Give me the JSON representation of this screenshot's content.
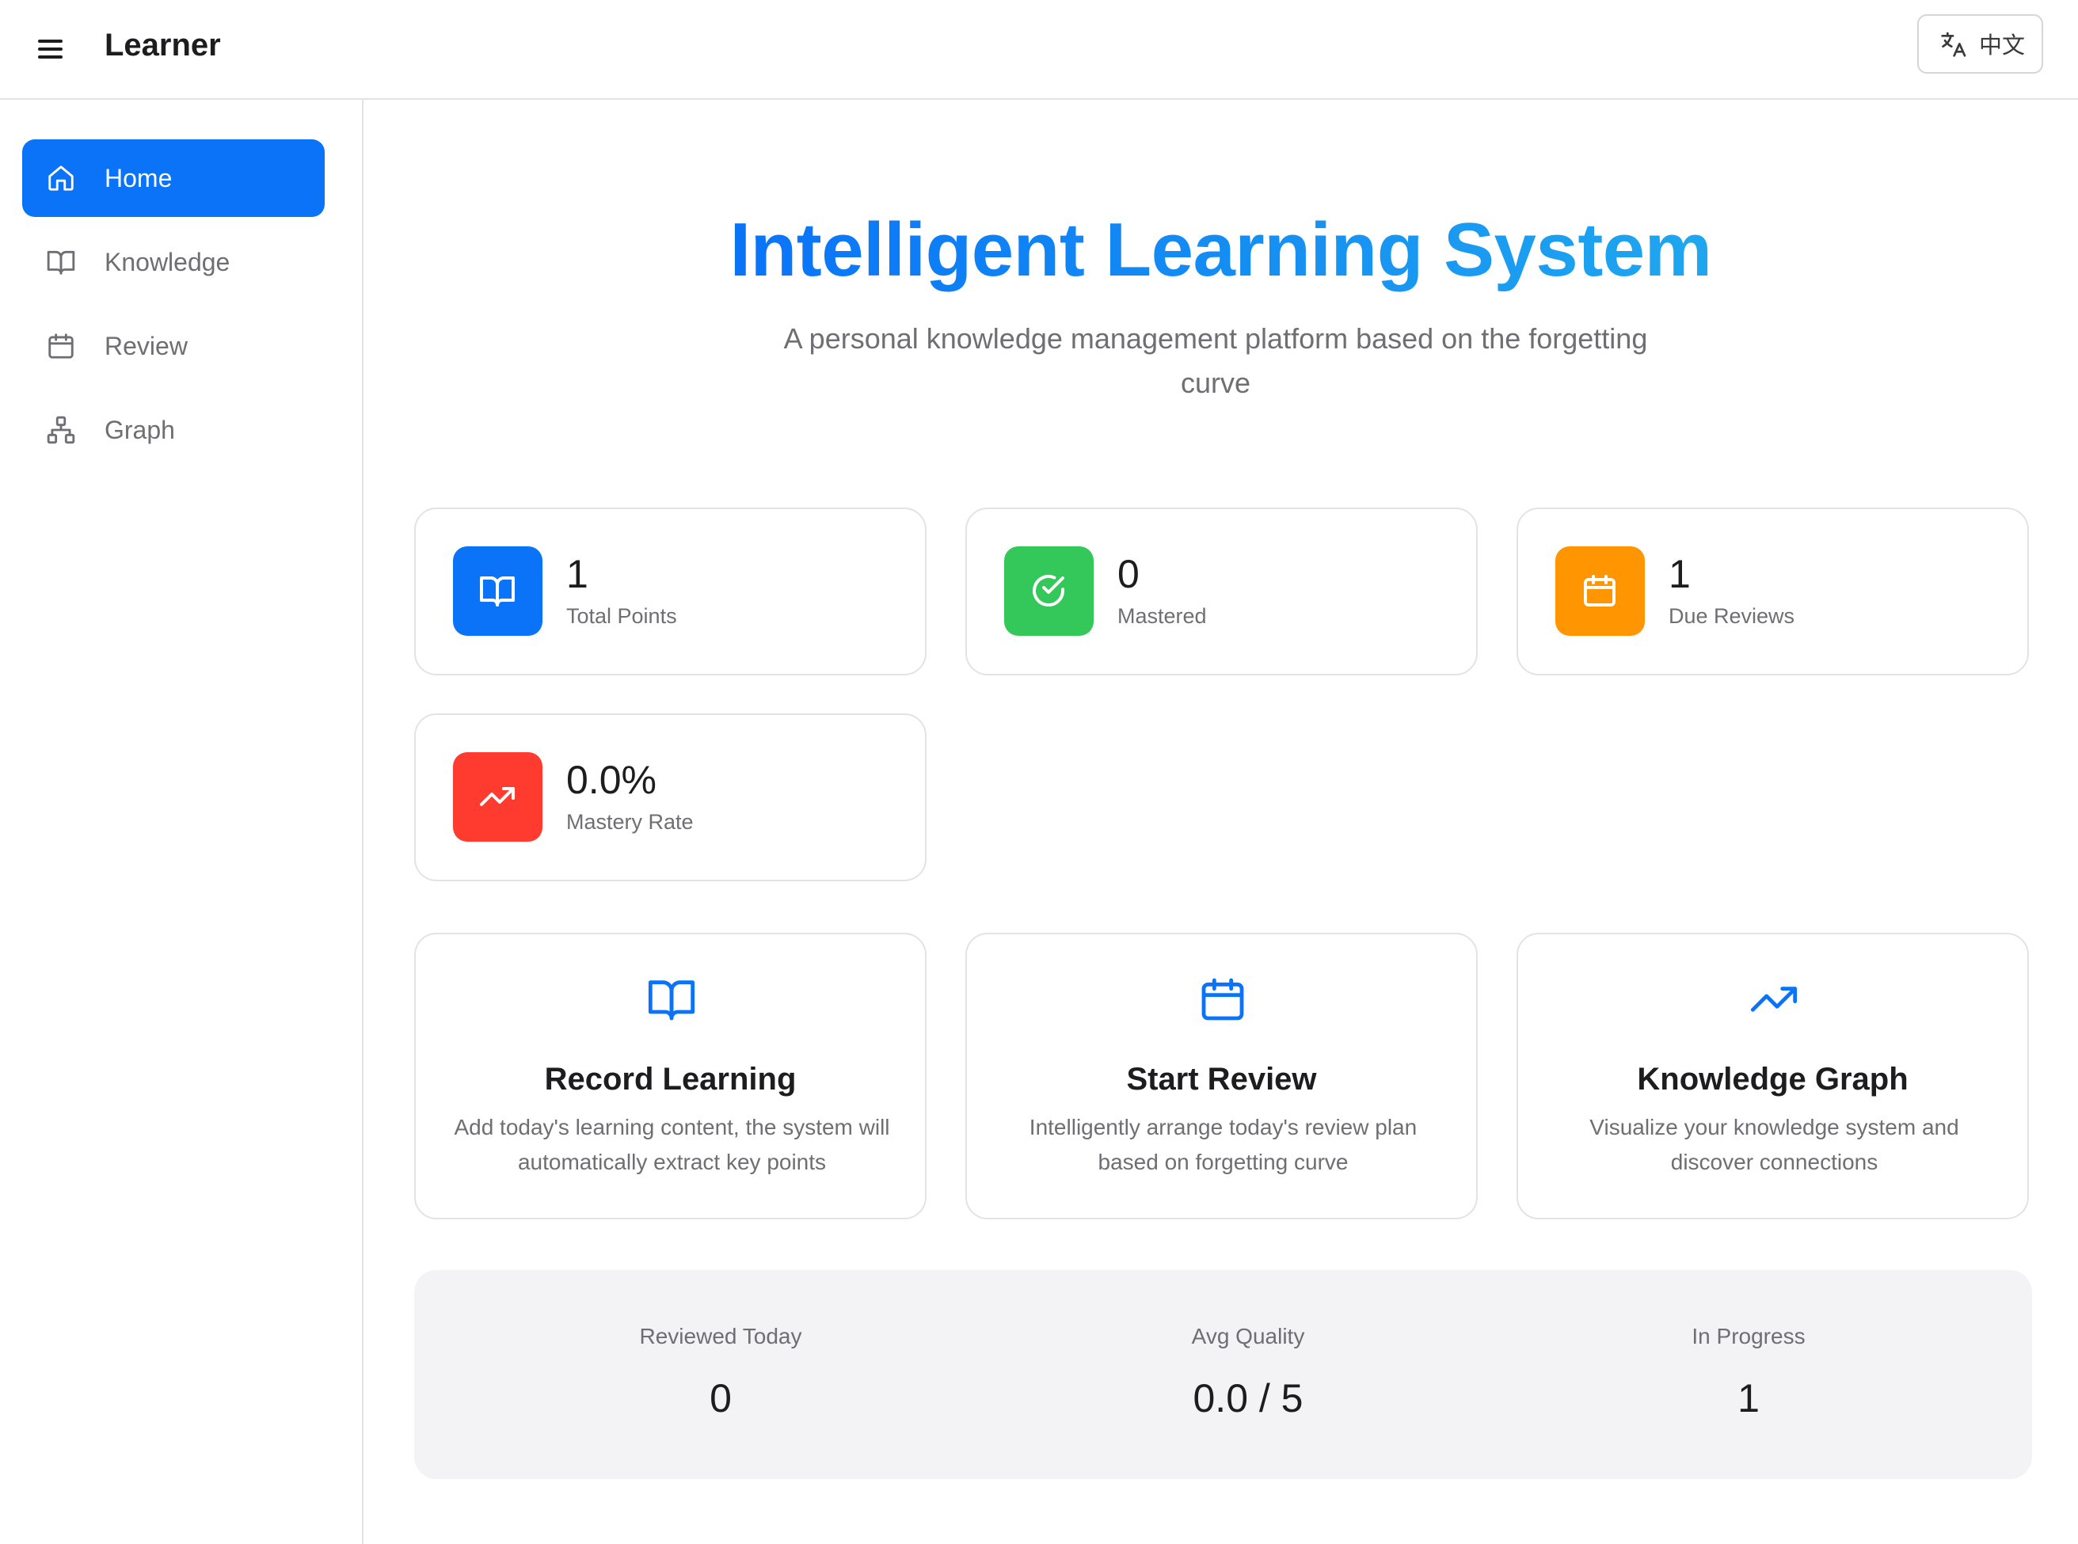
{
  "header": {
    "app_title": "Learner",
    "language_button": "中文"
  },
  "sidebar": {
    "items": [
      {
        "label": "Home",
        "icon": "home-icon",
        "active": true
      },
      {
        "label": "Knowledge",
        "icon": "book-icon",
        "active": false
      },
      {
        "label": "Review",
        "icon": "calendar-icon",
        "active": false
      },
      {
        "label": "Graph",
        "icon": "graph-icon",
        "active": false
      }
    ]
  },
  "hero": {
    "title": "Intelligent Learning System",
    "subtitle": "A personal knowledge management platform based on the forgetting curve"
  },
  "stats": [
    {
      "value": "1",
      "label": "Total Points",
      "icon": "book-icon",
      "color": "#0a73f7"
    },
    {
      "value": "0",
      "label": "Mastered",
      "icon": "check-circle-icon",
      "color": "#34c759"
    },
    {
      "value": "1",
      "label": "Due Reviews",
      "icon": "calendar-icon",
      "color": "#ff9500"
    },
    {
      "value": "0.0%",
      "label": "Mastery Rate",
      "icon": "trending-up-icon",
      "color": "#ff3b30"
    }
  ],
  "actions": [
    {
      "title": "Record Learning",
      "description": "Add today's learning content, the system will automatically extract key points",
      "icon": "book-icon"
    },
    {
      "title": "Start Review",
      "description": "Intelligently arrange today's review plan based on forgetting curve",
      "icon": "calendar-icon"
    },
    {
      "title": "Knowledge Graph",
      "description": "Visualize your knowledge system and discover connections",
      "icon": "trending-up-icon"
    }
  ],
  "summary": [
    {
      "label": "Reviewed Today",
      "value": "0"
    },
    {
      "label": "Avg Quality",
      "value": "0.0 / 5"
    },
    {
      "label": "In Progress",
      "value": "1"
    }
  ],
  "colors": {
    "accent": "#0a73f7",
    "title_gradient_end": "#1fa7ef"
  }
}
